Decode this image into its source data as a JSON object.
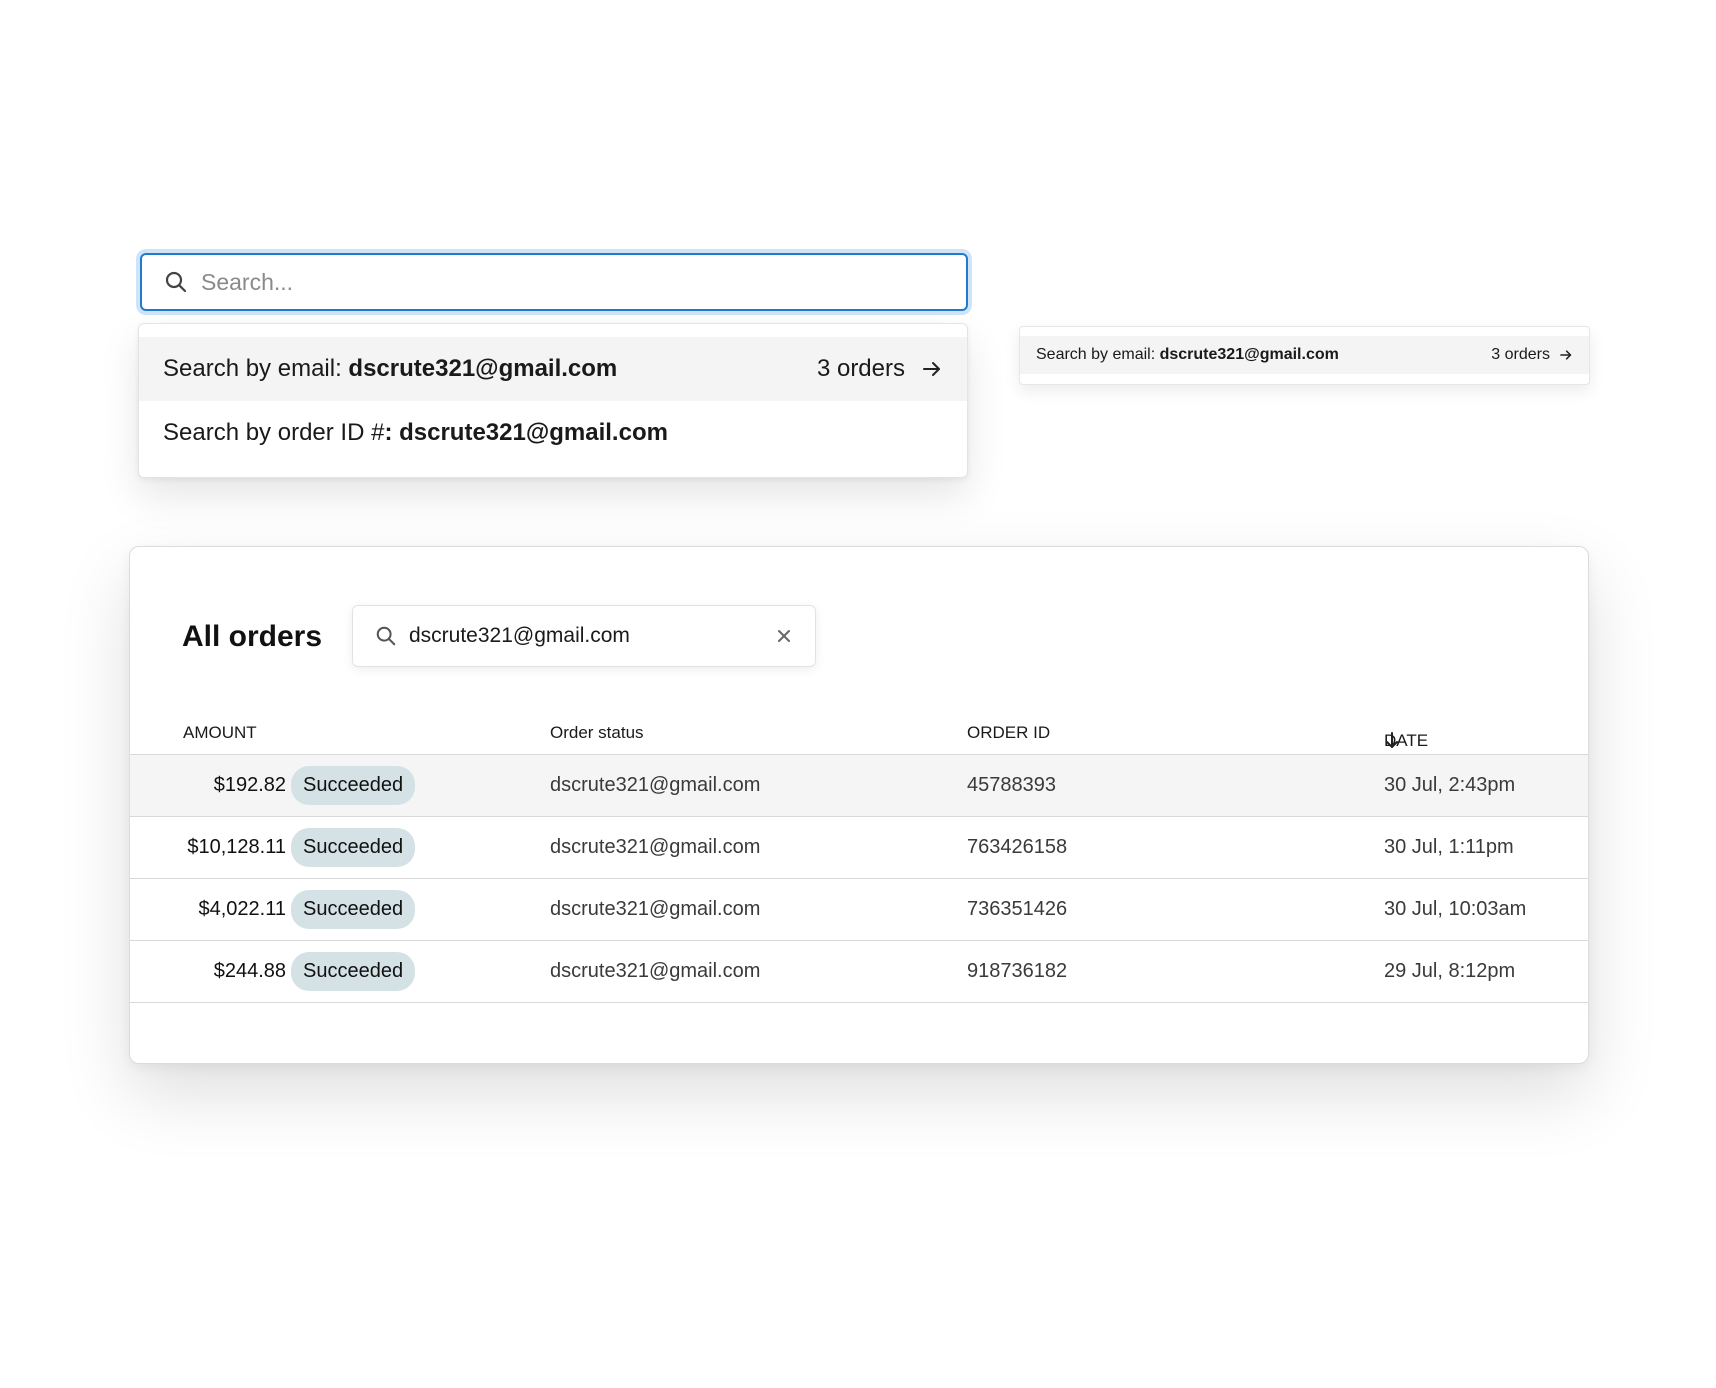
{
  "search": {
    "placeholder": "Search...",
    "icon": "search-icon"
  },
  "dropdown": {
    "email_option": {
      "prefix": "Search by email: ",
      "value": "dscrute321@gmail.com",
      "count": "3 orders",
      "icon": "arrow-right-icon"
    },
    "order_option": {
      "prefix": "Search by order ID #",
      "colon": ": ",
      "value": "dscrute321@gmail.com"
    }
  },
  "mini_dropdown": {
    "prefix": "Search by email: ",
    "value": "dscrute321@gmail.com",
    "count": "3 orders",
    "icon": "arrow-right-icon"
  },
  "orders": {
    "title": "All orders",
    "search_value": "dscrute321@gmail.com",
    "clear_icon": "close-icon",
    "columns": {
      "amount": "AMOUNT",
      "status": "Order status",
      "order_id": "ORDER ID",
      "date": "DATE",
      "date_sort_icon": "arrow-down-icon"
    },
    "rows": [
      {
        "amount": "$192.82",
        "status": "Succeeded",
        "email": "dscrute321@gmail.com",
        "order_id": "45788393",
        "date": "30 Jul, 2:43pm"
      },
      {
        "amount": "$10,128.11",
        "status": "Succeeded",
        "email": "dscrute321@gmail.com",
        "order_id": "763426158",
        "date": "30 Jul, 1:11pm"
      },
      {
        "amount": "$4,022.11",
        "status": "Succeeded",
        "email": "dscrute321@gmail.com",
        "order_id": "736351426",
        "date": "30 Jul, 10:03am"
      },
      {
        "amount": "$244.88",
        "status": "Succeeded",
        "email": "dscrute321@gmail.com",
        "order_id": "918736182",
        "date": "29 Jul, 8:12pm"
      }
    ]
  },
  "colors": {
    "focus_border": "#1f7bd1",
    "focus_ring": "#cfe4f6",
    "badge_bg": "#d4e2e6",
    "highlight_row": "#f4f4f4"
  }
}
